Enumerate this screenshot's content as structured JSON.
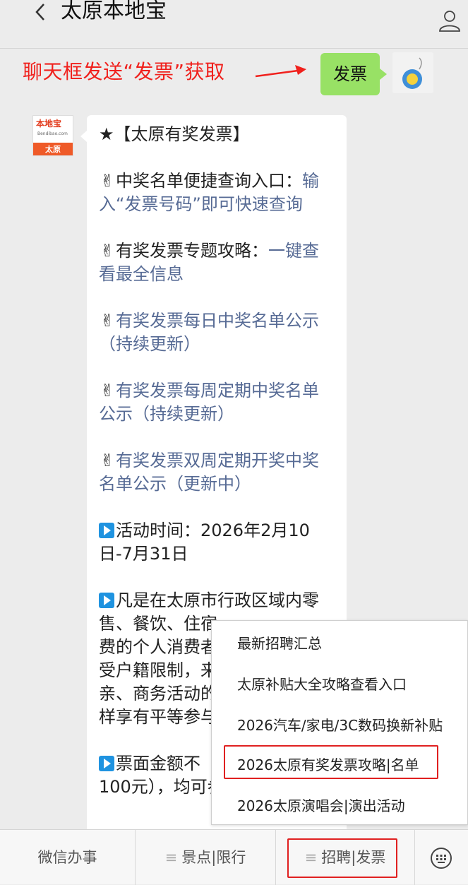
{
  "header": {
    "title": "太原本地宝"
  },
  "banner": {
    "text": "聊天框发送“发票”获取",
    "bubble_text": "发票"
  },
  "bot_avatar": {
    "brand": "本地宝",
    "sub": "Bendibao.com",
    "city": "太原"
  },
  "message": {
    "title": "★【太原有奖发票】",
    "items": [
      {
        "emoji": "✌",
        "prefix": "中奖名单便捷查询入口：",
        "link": "输入“发票号码”即可快速查询"
      },
      {
        "emoji": "✌",
        "prefix": "有奖发票专题攻略：",
        "link": "一键查看最全信息"
      },
      {
        "emoji": "✌",
        "prefix": "",
        "link": "有奖发票每日中奖名单公示（持续更新）"
      },
      {
        "emoji": "✌",
        "prefix": "",
        "link": "有奖发票每周定期中奖名单公示（持续更新）"
      },
      {
        "emoji": "✌",
        "prefix": "",
        "link": "有奖发票双周定期开奖中奖名单公示（更新中）"
      }
    ],
    "activity_time": "活动时间：2026年2月10日-7月31日",
    "para1": "凡是在太原市行政区域内零售、餐饮、住宿…费的个人消费者…受户籍限制，来…亲、商务活动的…样享有平等参与",
    "para1_lines": [
      "凡是在太原市行政区域内零",
      "售、餐饮、住宿",
      "费的个人消费者",
      "受户籍限制，来",
      "亲、商务活动的",
      "样享有平等参与"
    ],
    "para2_lines": [
      "票面金额不",
      "100元），均可参"
    ]
  },
  "popup_menu": {
    "items": [
      "最新招聘汇总",
      "太原补贴大全攻略查看入口",
      "2026汽车/家电/3C数码换新补贴",
      "2026太原有奖发票攻略|名单",
      "2026太原演唱会|演出活动"
    ]
  },
  "bottom_bar": {
    "tabs": [
      "微信办事",
      "景点|限行",
      "招聘|发票"
    ]
  },
  "colors": {
    "accent_red": "#e02020",
    "link": "#576b95",
    "green": "#98e165"
  }
}
